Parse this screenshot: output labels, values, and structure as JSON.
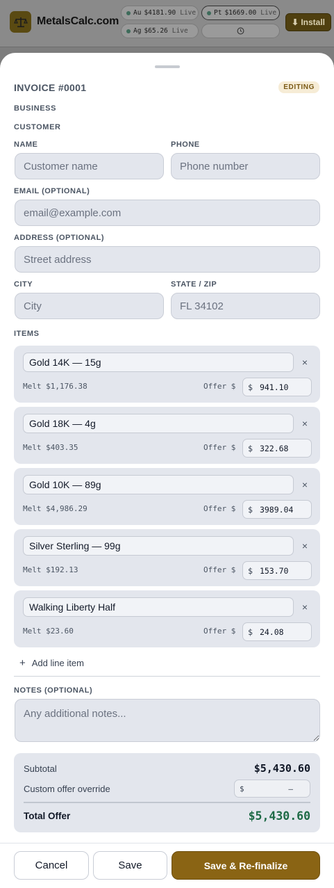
{
  "app": {
    "brand": "MetalsCalc.com",
    "install_label": "⬇ Install",
    "tickers": [
      {
        "symbol": "Au",
        "price": "$4181.90",
        "status": "Live"
      },
      {
        "symbol": "Pt",
        "price": "$1669.00",
        "status": "Live"
      },
      {
        "symbol": "Ag",
        "price": "$65.26",
        "status": "Live"
      }
    ],
    "clock_icon": "clock-icon"
  },
  "invoice": {
    "title": "INVOICE #0001",
    "status_badge": "EDITING",
    "business_heading": "BUSINESS",
    "customer_heading": "CUSTOMER"
  },
  "customer": {
    "name_label": "NAME",
    "name_placeholder": "Customer name",
    "phone_label": "PHONE",
    "phone_placeholder": "Phone number",
    "email_label": "EMAIL (OPTIONAL)",
    "email_placeholder": "email@example.com",
    "address_label": "ADDRESS (OPTIONAL)",
    "address_placeholder": "Street address",
    "city_label": "CITY",
    "city_placeholder": "City",
    "state_zip_label": "STATE / ZIP",
    "state_zip_placeholder": "FL 34102"
  },
  "items": {
    "heading": "ITEMS",
    "offer_label": "Offer $",
    "currency": "$",
    "remove_glyph": "×",
    "list": [
      {
        "name": "Gold 14K — 15g",
        "melt": "Melt $1,176.38",
        "offer": "941.10"
      },
      {
        "name": "Gold 18K — 4g",
        "melt": "Melt $403.35",
        "offer": "322.68"
      },
      {
        "name": "Gold 10K — 89g",
        "melt": "Melt $4,986.29",
        "offer": "3989.04"
      },
      {
        "name": "Silver Sterling — 99g",
        "melt": "Melt $192.13",
        "offer": "153.70"
      },
      {
        "name": "Walking Liberty Half",
        "melt": "Melt $23.60",
        "offer": "24.08"
      }
    ],
    "add_label": "Add line item",
    "add_glyph": "+"
  },
  "notes": {
    "label": "NOTES (OPTIONAL)",
    "placeholder": "Any additional notes..."
  },
  "totals": {
    "subtotal_label": "Subtotal",
    "subtotal_value": "$5,430.60",
    "override_label": "Custom offer override",
    "override_currency": "$",
    "override_value": "—",
    "total_label": "Total Offer",
    "total_value": "$5,430.60",
    "total_color": "#1e6a46"
  },
  "actions": {
    "cancel": "Cancel",
    "save": "Save",
    "save_refinalize": "Save & Re-finalize",
    "primary_color": "#8a6414"
  }
}
